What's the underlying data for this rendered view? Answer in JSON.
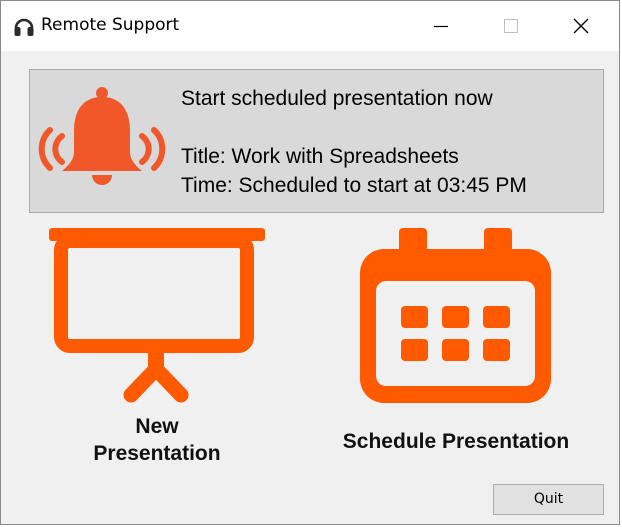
{
  "window": {
    "title": "Remote Support",
    "icon": "headset-icon",
    "controls": [
      "minimize-icon",
      "maximize-icon",
      "close-icon"
    ]
  },
  "banner": {
    "icon": "ringing-bell-icon",
    "heading": "Start scheduled presentation now",
    "title_line": "Title: Work with Spreadsheets",
    "time_line": "Time: Scheduled to start at 03:45 PM"
  },
  "tiles": {
    "new_presentation": {
      "icon": "projector-screen-icon",
      "label_line1": "New",
      "label_line2": "Presentation"
    },
    "schedule_presentation": {
      "icon": "calendar-icon",
      "label": "Schedule Presentation"
    }
  },
  "footer": {
    "quit_label": "Quit"
  },
  "colors": {
    "accent_orange": "#ff5a00",
    "bell_orange": "#f0582a",
    "window_bg": "#f0f0f0",
    "banner_bg": "#d9d9d9"
  }
}
